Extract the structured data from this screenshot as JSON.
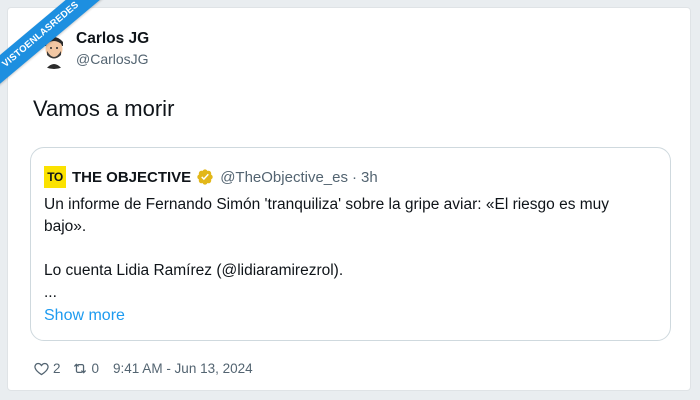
{
  "watermark": "VISTOENLASREDES",
  "tweet": {
    "author_name": "Carlos JG",
    "author_handle": "@CarlosJG",
    "text": "Vamos a morir",
    "likes": "2",
    "retweets": "0",
    "timestamp": "9:41 AM - Jun 13, 2024"
  },
  "quote": {
    "logo_text": "TO",
    "author_name": "THE OBJECTIVE",
    "author_handle": "@TheObjective_es",
    "separator": "·",
    "time": "3h",
    "paragraph1": "Un informe de Fernando Simón 'tranquiliza' sobre la gripe aviar: «El riesgo es muy bajo».",
    "paragraph2": "Lo cuenta Lidia Ramírez (@lidiaramirezrol).",
    "ellipsis": "...",
    "show_more": "Show more"
  },
  "colors": {
    "accent": "#1d9bf0",
    "verified": "#e2b719",
    "logo_bg": "#fbe200",
    "watermark_bg": "#1d8fe0"
  },
  "icons": [
    "verified-badge-icon",
    "heart-icon",
    "retweet-icon"
  ]
}
